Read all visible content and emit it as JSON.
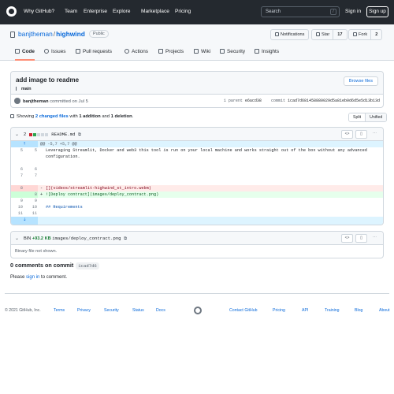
{
  "header": {
    "nav": [
      "Why GitHub?",
      "Team",
      "Enterprise",
      "Explore",
      "Marketplace",
      "Pricing"
    ],
    "search_placeholder": "Search",
    "search_shortcut": "/",
    "signin": "Sign in",
    "signup": "Sign up"
  },
  "repo": {
    "owner": "banjtheman",
    "sep": "/",
    "name": "highwind",
    "visibility": "Public",
    "notifications_label": "Notifications",
    "star_label": "Star",
    "star_count": "17",
    "fork_label": "Fork",
    "fork_count": "2",
    "tabs": [
      "Code",
      "Issues",
      "Pull requests",
      "Actions",
      "Projects",
      "Wiki",
      "Security",
      "Insights"
    ]
  },
  "commit": {
    "title": "add image to readme",
    "browse_files": "Browse files",
    "branch": "main",
    "author": "banjtheman",
    "committed_text": "committed on Jul 5",
    "parent_label": "1 parent",
    "parent_sha": "e6acd38",
    "commit_label": "commit",
    "commit_sha": "1cad7d681458880029d5a81eb0d6d5e5d13b13d"
  },
  "summary": {
    "prefix": "Showing",
    "changed_files": "2 changed files",
    "with": "with",
    "additions": "1 addition",
    "and": "and",
    "deletions": "1 deletion",
    "split": "Split",
    "unified": "Unified"
  },
  "file1": {
    "count": "2",
    "name": "README.md",
    "hunk": "@@ -5,7 +5,7 @@",
    "lines": [
      {
        "type": "ctx",
        "old": "5",
        "new": "5",
        "mk": " ",
        "text": "Leveraging Streamlit, Docker and web3 this tool is run on your local machine and works straight out of the box without any advanced"
      },
      {
        "type": "ctx",
        "old": "",
        "new": "",
        "mk": " ",
        "text": "configuration."
      },
      {
        "type": "ctx",
        "old": "",
        "new": "",
        "mk": " ",
        "text": ""
      },
      {
        "type": "ctx",
        "old": "6",
        "new": "6",
        "mk": " ",
        "text": ""
      },
      {
        "type": "ctx",
        "old": "7",
        "new": "7",
        "mk": " ",
        "text": ""
      },
      {
        "type": "ctx",
        "old": "",
        "new": "",
        "mk": " ",
        "text": ""
      },
      {
        "type": "del",
        "old": "8",
        "new": "",
        "mk": "-",
        "text": "[](videos/streamlit-highwind_st_intro.webm)"
      },
      {
        "type": "add",
        "old": "",
        "new": "8",
        "mk": "+",
        "text": "![Deploy contract](images/deploy_contract.png)"
      },
      {
        "type": "ctx",
        "old": "9",
        "new": "9",
        "mk": " ",
        "text": ""
      },
      {
        "type": "ctx",
        "old": "10",
        "new": "10",
        "mk": " ",
        "text": "## Requirements"
      },
      {
        "type": "ctx",
        "old": "11",
        "new": "11",
        "mk": " ",
        "text": ""
      }
    ]
  },
  "file2": {
    "type": "BIN",
    "size": "+93.2 KB",
    "name": "images/deploy_contract.png",
    "message": "Binary file not shown."
  },
  "comments": {
    "heading": "0 comments on commit",
    "sha": "1cad7d6",
    "please": "Please",
    "signin_link": "sign in",
    "to_comment": "to comment."
  },
  "footer": {
    "copyright": "© 2021 GitHub, Inc.",
    "links_left": [
      "Terms",
      "Privacy",
      "Security",
      "Status",
      "Docs"
    ],
    "links_right": [
      "Contact GitHub",
      "Pricing",
      "API",
      "Training",
      "Blog",
      "About"
    ]
  },
  "colors": {
    "header_bg": "#24292f",
    "link": "#0969da",
    "add_bg": "#e6ffec",
    "del_bg": "#ffebe9",
    "hunk_bg": "#ddf4ff",
    "tab_underline": "#fd8c73"
  }
}
